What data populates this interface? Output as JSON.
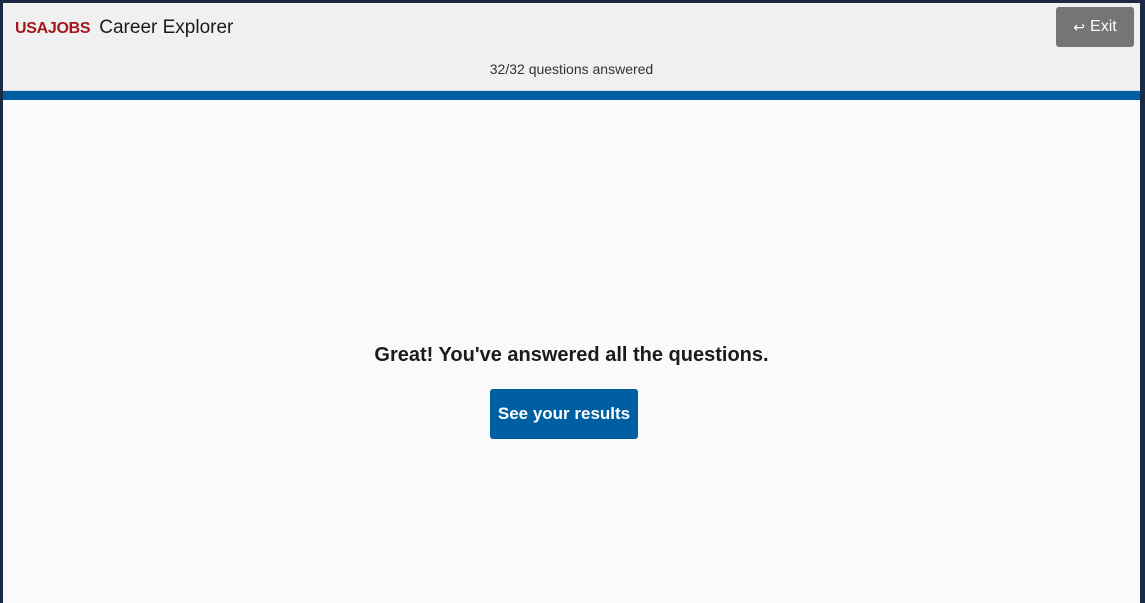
{
  "header": {
    "logo_text": "USAJOBS",
    "app_title": "Career Explorer",
    "exit_label": "Exit",
    "exit_icon": "return-arrow-icon",
    "progress_text": "32/32 questions answered"
  },
  "progress": {
    "answered": 32,
    "total": 32,
    "fraction": 1.0
  },
  "main": {
    "completion_message": "Great! You've answered all the questions.",
    "results_button_label": "See your results"
  },
  "colors": {
    "brand_red": "#a4161a",
    "primary_blue": "#005ea2",
    "exit_gray": "#757575",
    "frame_navy": "#1b2a44"
  }
}
